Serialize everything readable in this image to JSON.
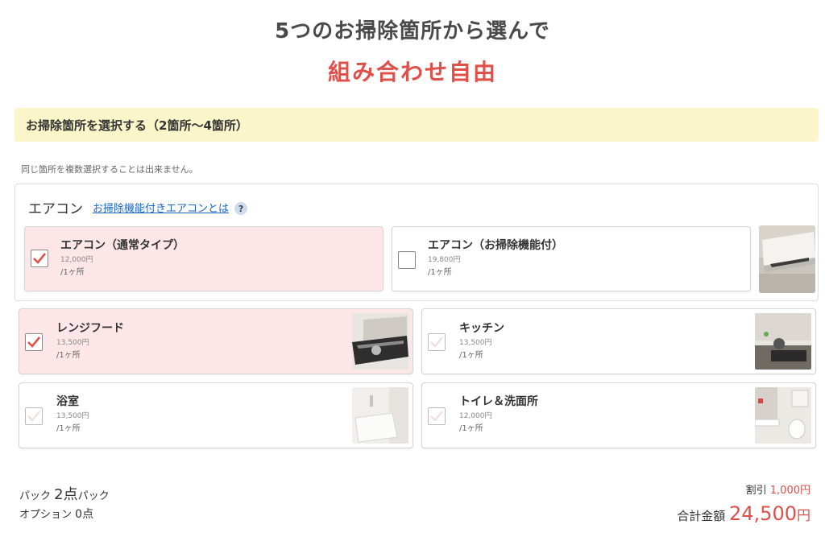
{
  "header": {
    "title": "5つのお掃除箇所から選んで",
    "subtitle": "組み合わせ自由"
  },
  "section": {
    "label": "お掃除箇所を選択する（2箇所〜4箇所）",
    "note": "同じ箇所を複数選択することは出来ません。"
  },
  "aircon": {
    "label": "エアコン",
    "link": "お掃除機能付きエアコンとは",
    "help": "?",
    "options": [
      {
        "name": "エアコン（通常タイプ）",
        "price": "12,000円",
        "unit": "/1ヶ所",
        "checked": true
      },
      {
        "name": "エアコン（お掃除機能付）",
        "price": "19,800円",
        "unit": "/1ヶ所",
        "checked": false
      }
    ]
  },
  "items": [
    {
      "name": "レンジフード",
      "price": "13,500円",
      "unit": "/1ヶ所",
      "checked": true
    },
    {
      "name": "キッチン",
      "price": "13,500円",
      "unit": "/1ヶ所",
      "checked": false
    },
    {
      "name": "浴室",
      "price": "13,500円",
      "unit": "/1ヶ所",
      "checked": false
    },
    {
      "name": "トイレ＆洗面所",
      "price": "12,000円",
      "unit": "/1ヶ所",
      "checked": false
    }
  ],
  "summary": {
    "pack_label": "パック",
    "pack_count": "2点",
    "pack_suffix": "パック",
    "option_label": "オプション",
    "option_count": "0点",
    "discount_label": "割引",
    "discount_value": "1,000円",
    "total_label": "合計金額",
    "total_value": "24,500",
    "total_unit": "円"
  },
  "colors": {
    "accent": "#e0504a",
    "selected_bg": "#fde6e8",
    "section_bg": "#fbf6c9",
    "link": "#1a66c9"
  }
}
